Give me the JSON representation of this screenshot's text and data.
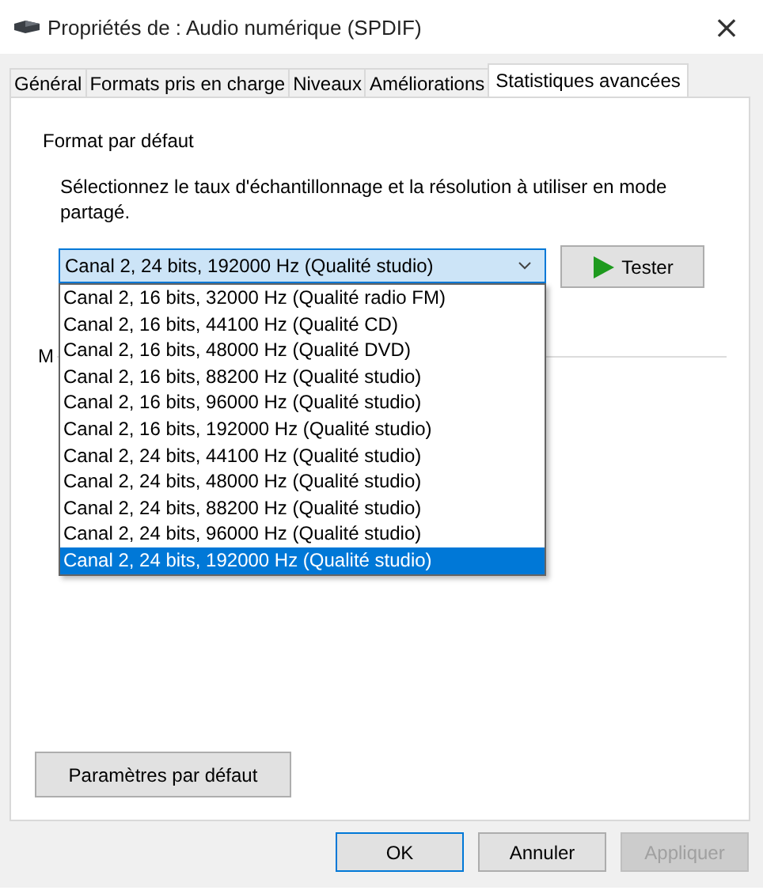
{
  "window": {
    "title": "Propriétés de : Audio numérique (SPDIF)",
    "close": "×"
  },
  "tabs": [
    {
      "label": "Général",
      "selected": false
    },
    {
      "label": "Formats pris en charge",
      "selected": false
    },
    {
      "label": "Niveaux",
      "selected": false
    },
    {
      "label": "Améliorations",
      "selected": false
    },
    {
      "label": "Statistiques avancées",
      "selected": true
    }
  ],
  "default_format": {
    "heading": "Format par défaut",
    "description": "Sélectionnez le taux d'échantillonnage et la résolution à utiliser en mode partagé.",
    "combo_value": "Canal 2, 24 bits, 192000 Hz (Qualité studio)",
    "test_button": "Tester",
    "options": [
      {
        "label": "Canal 2, 16 bits, 32000 Hz (Qualité radio FM)",
        "selected": false
      },
      {
        "label": "Canal 2, 16 bits, 44100 Hz (Qualité CD)",
        "selected": false
      },
      {
        "label": "Canal 2, 16 bits, 48000 Hz (Qualité DVD)",
        "selected": false
      },
      {
        "label": "Canal 2, 16 bits, 88200 Hz (Qualité studio)",
        "selected": false
      },
      {
        "label": "Canal 2, 16 bits, 96000 Hz (Qualité studio)",
        "selected": false
      },
      {
        "label": "Canal 2, 16 bits, 192000 Hz (Qualité studio)",
        "selected": false
      },
      {
        "label": "Canal 2, 24 bits, 44100 Hz (Qualité studio)",
        "selected": false
      },
      {
        "label": "Canal 2, 24 bits, 48000 Hz (Qualité studio)",
        "selected": false
      },
      {
        "label": "Canal 2, 24 bits, 88200 Hz (Qualité studio)",
        "selected": false
      },
      {
        "label": "Canal 2, 24 bits, 96000 Hz (Qualité studio)",
        "selected": false
      },
      {
        "label": "Canal 2, 24 bits, 192000 Hz (Qualité studio)",
        "selected": true
      }
    ]
  },
  "group_2": {
    "heading": "M"
  },
  "defaults_button": "Paramètres par défaut",
  "buttons": [
    {
      "label": "OK",
      "disabled": false
    },
    {
      "label": "Annuler",
      "disabled": false
    },
    {
      "label": "Appliquer",
      "disabled": true
    }
  ]
}
